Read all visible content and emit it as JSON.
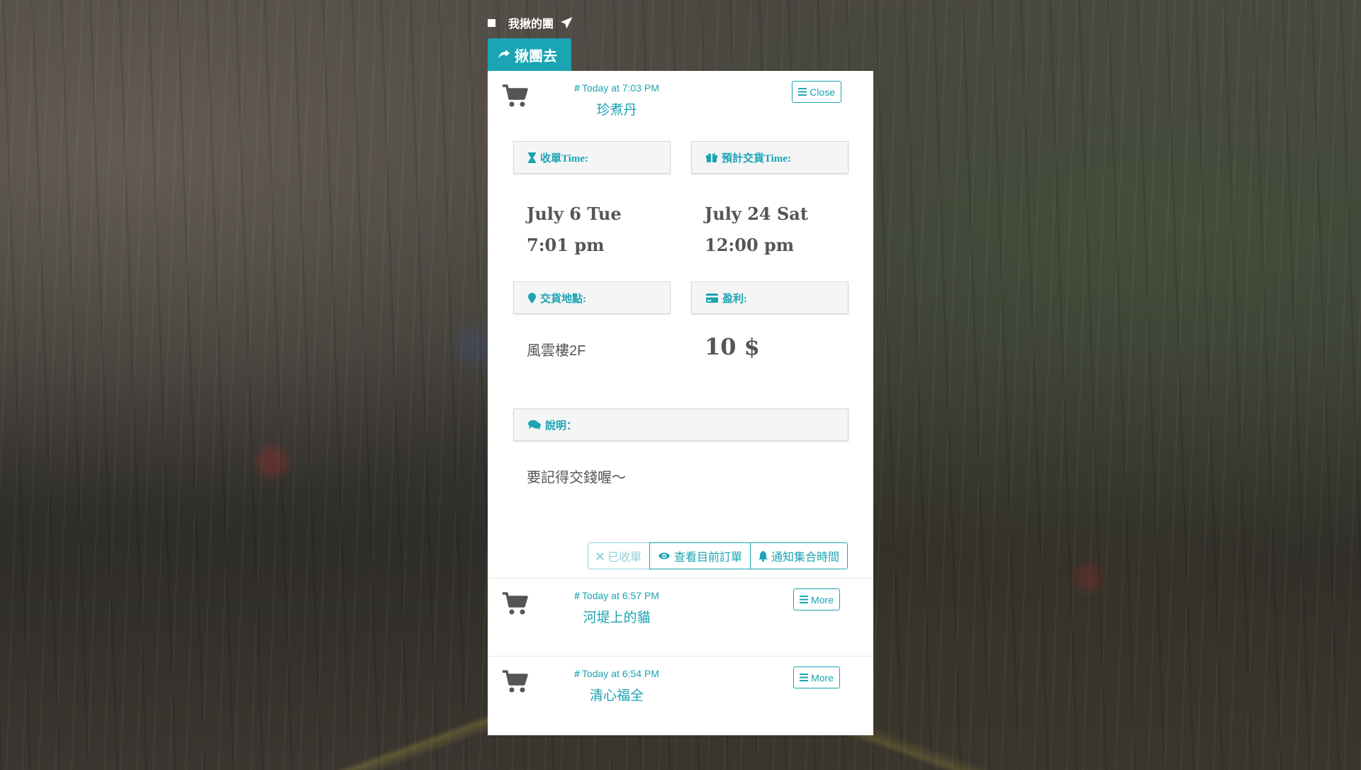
{
  "nav": {
    "title": "我揪的團"
  },
  "go_button": {
    "label": "揪團去"
  },
  "groups": [
    {
      "time": "Today at 7:03 PM",
      "name": "珍煮丹",
      "toggle_label": "Close",
      "close_time_label": "收單Time:",
      "delivery_time_label": "預計交貨Time:",
      "close_date": "July 6 Tue",
      "close_clock": "7:01 pm",
      "delivery_date": "July 24 Sat",
      "delivery_clock": "12:00 pm",
      "location_label": "交貨地點:",
      "location": "風雲樓2F",
      "profit_label": "盈利:",
      "profit": "10 $",
      "note_label": "說明：",
      "note": "要記得交錢喔～",
      "actions": {
        "closed": "已收單",
        "view_orders": "查看目前訂單",
        "notify": "通知集合時間"
      }
    },
    {
      "time": "Today at 6:57 PM",
      "name": "河堤上的貓",
      "toggle_label": "More"
    },
    {
      "time": "Today at 6:54 PM",
      "name": "清心福全",
      "toggle_label": "More"
    }
  ],
  "colors": {
    "accent": "#1aa4b4",
    "text": "#555555"
  }
}
